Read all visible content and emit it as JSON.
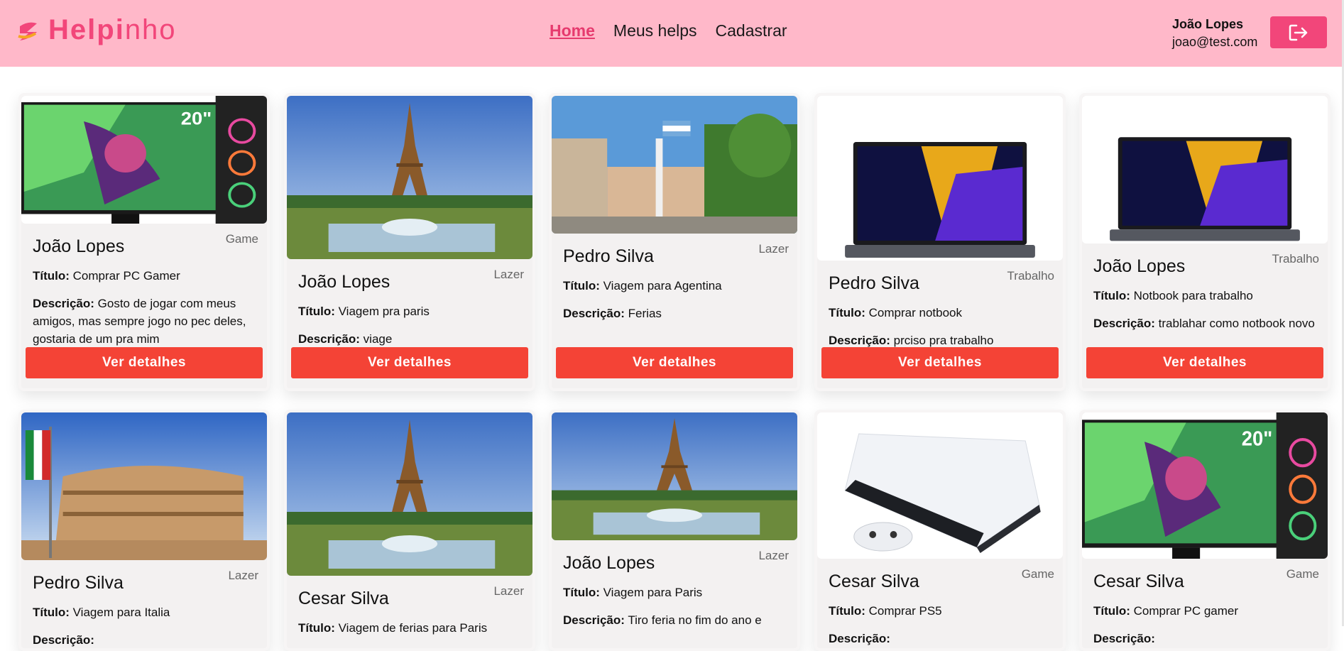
{
  "header": {
    "logo_bold": "Help",
    "logo_mid": "i",
    "logo_end": "nho",
    "nav": [
      "Home",
      "Meus helps",
      "Cadastrar"
    ],
    "user_name": "João Lopes",
    "user_email": "joao@test.com",
    "colors": {
      "header_bg": "#ffb8c9",
      "accent": "#f2467a",
      "button": "#f44336"
    }
  },
  "labels": {
    "title": "Título:",
    "description": "Descrição:",
    "details_button": "Ver detalhes"
  },
  "cards": [
    {
      "name": "João Lopes",
      "category": "Game",
      "title": "Comprar PC Gamer",
      "description": "Gosto de jogar com meus amigos, mas sempre jogo no pec deles, gostaria de um pra mim",
      "image": "pc-gamer-image"
    },
    {
      "name": "João Lopes",
      "category": "Lazer",
      "title": "Viagem pra paris",
      "description": "viage",
      "image": "eiffel-tower-image"
    },
    {
      "name": "Pedro Silva",
      "category": "Lazer",
      "title": "Viagem para Agentina",
      "description": "Ferias",
      "image": "buenos-aires-image"
    },
    {
      "name": "Pedro Silva",
      "category": "Trabalho",
      "title": "Comprar notbook",
      "description": "prciso pra trabalho",
      "image": "laptop-image"
    },
    {
      "name": "João Lopes",
      "category": "Trabalho",
      "title": "Notbook para trabalho",
      "description": "trablahar como notbook novo",
      "image": "laptop-image"
    },
    {
      "name": "Pedro Silva",
      "category": "Lazer",
      "title": "Viagem para Italia",
      "description": "",
      "image": "colosseum-image"
    },
    {
      "name": "Cesar Silva",
      "category": "Lazer",
      "title": "Viagem de ferias para Paris",
      "description": "",
      "image": "eiffel-tower-image"
    },
    {
      "name": "João Lopes",
      "category": "Lazer",
      "title": "Viagem para Paris",
      "description": "Tiro feria no fim do ano e",
      "image": "eiffel-tower-image"
    },
    {
      "name": "Cesar Silva",
      "category": "Game",
      "title": "Comprar PS5",
      "description": "",
      "image": "ps5-image"
    },
    {
      "name": "Cesar Silva",
      "category": "Game",
      "title": "Comprar PC gamer",
      "description": "",
      "image": "pc-gamer-image"
    }
  ]
}
